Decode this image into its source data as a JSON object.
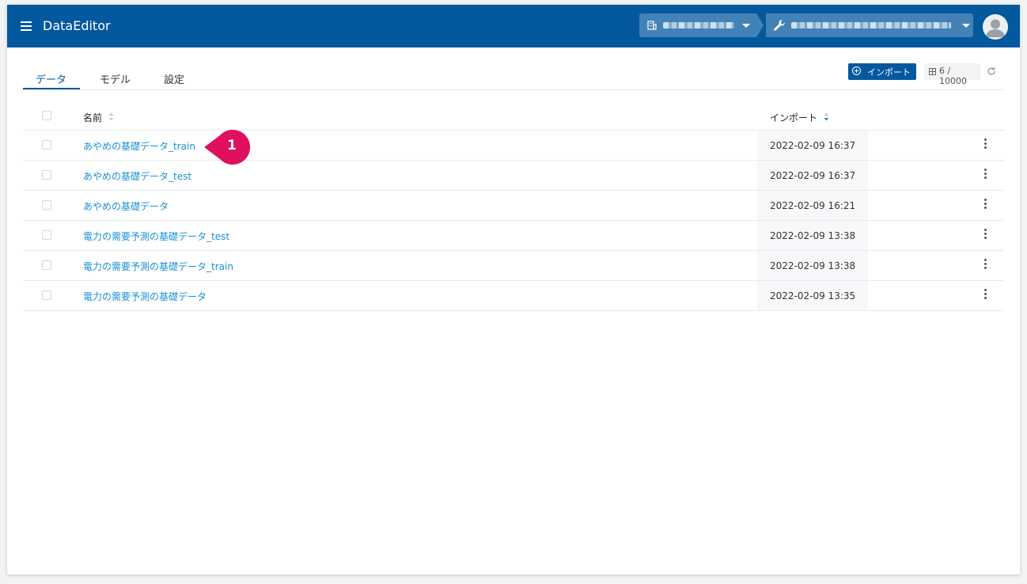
{
  "app": {
    "title": "DataEditor"
  },
  "header": {
    "org_select": {
      "icon": "building-icon",
      "value_obscured": true
    },
    "project_select": {
      "icon": "wrench-icon",
      "value_obscured": true
    }
  },
  "tabs": [
    {
      "label": "データ",
      "active": true
    },
    {
      "label": "モデル",
      "active": false
    },
    {
      "label": "設定",
      "active": false
    }
  ],
  "toolbar": {
    "import_label": "インポート",
    "quota": "6 / 10000"
  },
  "table": {
    "columns": {
      "name": "名前",
      "imported": "インポート"
    },
    "rows": [
      {
        "name": "あやめの基礎データ_train",
        "imported": "2022-02-09 16:37"
      },
      {
        "name": "あやめの基礎データ_test",
        "imported": "2022-02-09 16:37"
      },
      {
        "name": "あやめの基礎データ",
        "imported": "2022-02-09 16:21"
      },
      {
        "name": "電力の需要予測の基礎データ_test",
        "imported": "2022-02-09 13:38"
      },
      {
        "name": "電力の需要予測の基礎データ_train",
        "imported": "2022-02-09 13:38"
      },
      {
        "name": "電力の需要予測の基礎データ",
        "imported": "2022-02-09 13:35"
      }
    ]
  },
  "annotation": {
    "number": "1",
    "color": "#e0105f"
  },
  "colors": {
    "header": "#04589e",
    "link": "#1a8fd6",
    "accent": "#04589e"
  }
}
